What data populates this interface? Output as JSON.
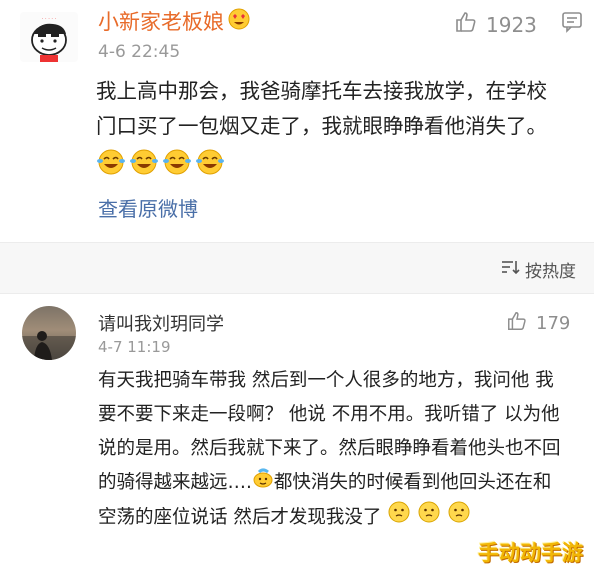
{
  "comments": [
    {
      "username": "小新家老板娘",
      "date": "4-6 22:45",
      "likes": "1923",
      "text": "我上高中那会，我爸骑摩托车去接我放学，在学校门口买了一包烟又走了，我就眼睁睁看他消失了。",
      "trailing_emojis": [
        "laughing-emoji",
        "laughing-emoji",
        "laughing-emoji",
        "laughing-emoji"
      ],
      "link": "查看原微博",
      "avatar_icon": "crayon-shinchan-avatar",
      "username_emoji": "heart-eyes-emoji"
    },
    {
      "username": "请叫我刘玥同学",
      "date": "4-7 11:19",
      "likes": "179",
      "text_part1": "有天我把骑车带我 然后到一个人很多的地方，我问他 我要不要下来走一段啊？ 他说  不用不用。我听错了 以为他说的是用。然后我就下来了。然后眼睁睁看着他头也不回的骑得越来越远….",
      "text_part2": "都快消失的时候看到他回头还在和空荡的座位说话 然后才发现我没了",
      "avatar_icon": "silhouette-sunset-avatar"
    }
  ],
  "sort_label": "按热度",
  "watermark": "手动动手游",
  "colors": {
    "username_orange": "#e86b2a",
    "link_blue": "#4a6fa8",
    "meta_gray": "#999999",
    "watermark_yellow": "#f2b705"
  }
}
